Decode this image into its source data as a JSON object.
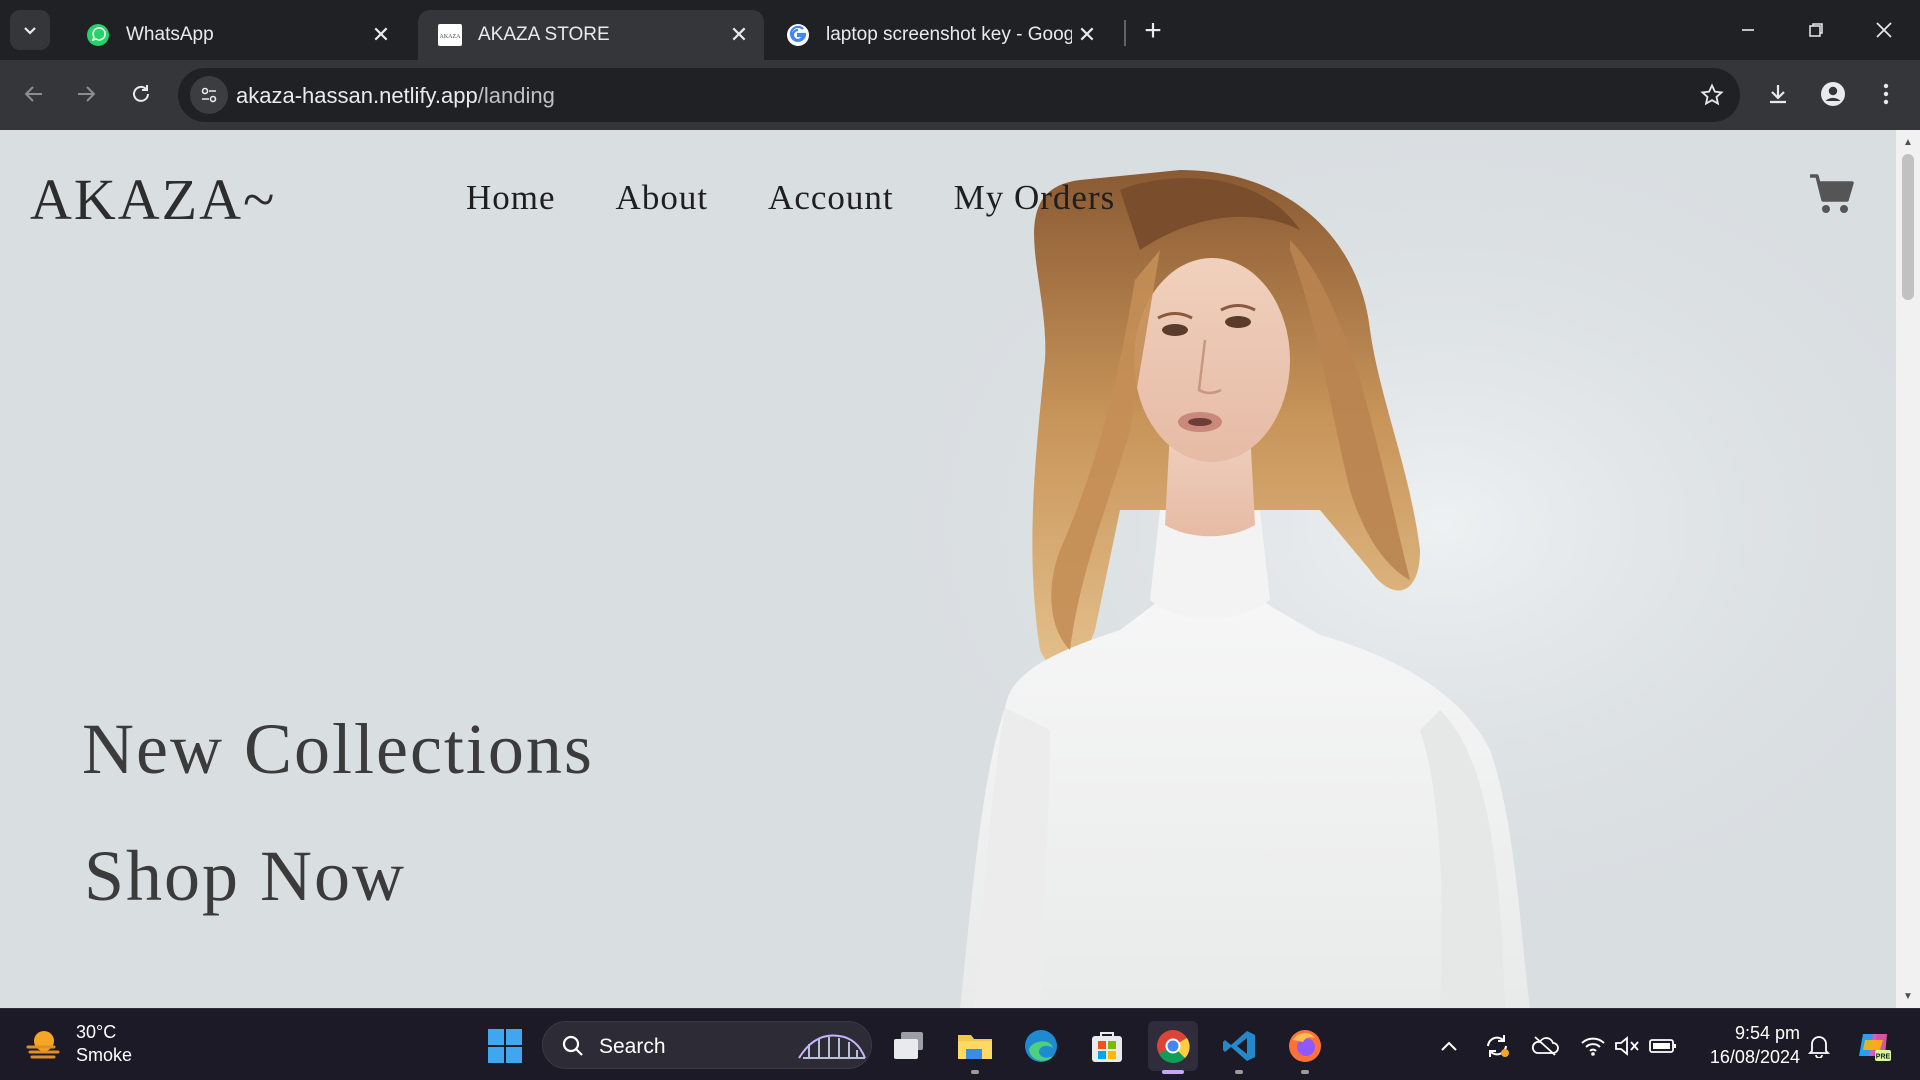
{
  "browser": {
    "tabs": [
      {
        "title": "WhatsApp",
        "icon": "whatsapp-icon",
        "active": false
      },
      {
        "title": "AKAZA STORE",
        "icon": "akaza-favicon",
        "active": true
      },
      {
        "title": "laptop screenshot key - Google",
        "icon": "google-icon",
        "active": false
      }
    ],
    "url_host": "akaza-hassan.netlify.app",
    "url_path": "/landing"
  },
  "page": {
    "logo": "AKAZA~",
    "nav": [
      "Home",
      "About",
      "Account",
      "My Orders"
    ],
    "hero_title": "New Collections",
    "hero_cta": "Shop Now",
    "cart_icon": "cart-icon"
  },
  "taskbar": {
    "weather_temp": "30°C",
    "weather_desc": "Smoke",
    "search_label": "Search",
    "time": "9:54 pm",
    "date": "16/08/2024",
    "apps": [
      "task-view",
      "file-explorer",
      "edge",
      "microsoft-store",
      "chrome",
      "vscode",
      "firefox"
    ]
  },
  "colors": {
    "page_bg": "#d9dee1",
    "chrome_dark": "#202124",
    "chrome_toolbar": "#35363a",
    "taskbar": "#1c1a26"
  }
}
